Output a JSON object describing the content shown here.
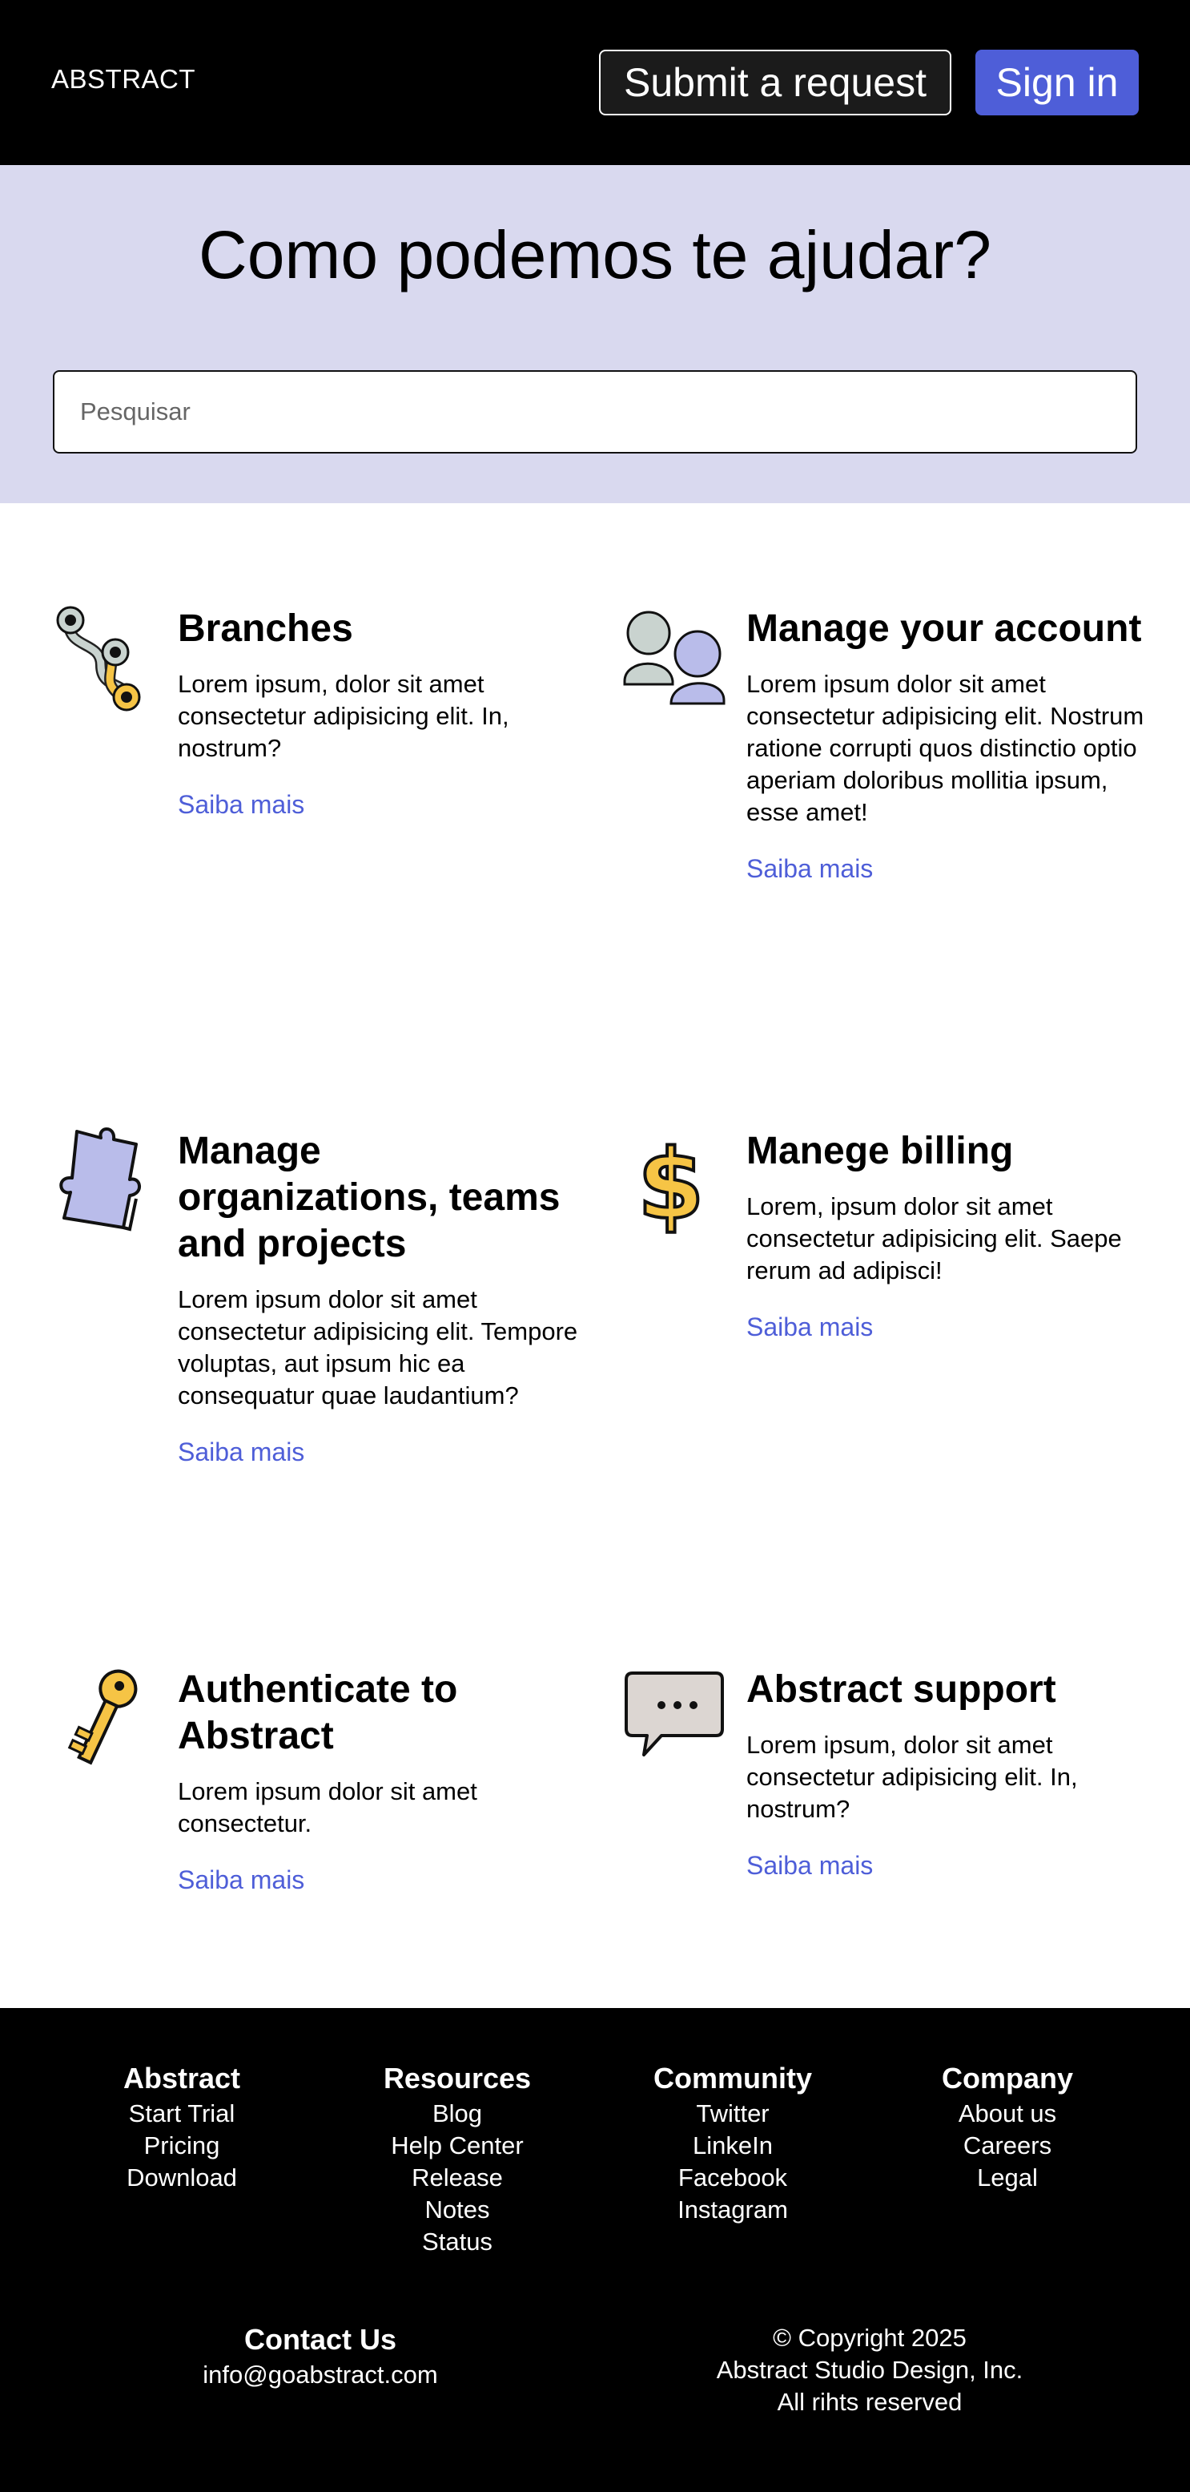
{
  "header": {
    "logo": "ABSTRACT",
    "submit_label": "Submit a request",
    "signin_label": "Sign in"
  },
  "hero": {
    "title": "Como podemos te ajudar?",
    "search_placeholder": "Pesquisar"
  },
  "cards": [
    {
      "title": "Branches",
      "text": "Lorem ipsum, dolor sit amet consectetur adipisicing elit. In, nostrum?",
      "link": "Saiba mais",
      "icon": "branches-icon"
    },
    {
      "title": "Manage your account",
      "text": "Lorem ipsum dolor sit amet consectetur adipisicing elit. Nostrum ratione corrupti quos distinctio optio aperiam doloribus mollitia ipsum, esse amet!",
      "link": "Saiba mais",
      "icon": "users-icon"
    },
    {
      "title": "Manage organizations, teams and projects",
      "text": "Lorem ipsum dolor sit amet consectetur adipisicing elit. Tempore voluptas, aut ipsum hic ea consequatur quae laudantium?",
      "link": "Saiba mais",
      "icon": "puzzle-icon"
    },
    {
      "title": "Manege billing",
      "text": "Lorem, ipsum dolor sit amet consectetur adipisicing elit. Saepe rerum ad adipisci!",
      "link": "Saiba mais",
      "icon": "dollar-icon"
    },
    {
      "title": "Authenticate to Abstract",
      "text": "Lorem ipsum dolor sit amet consectetur.",
      "link": "Saiba mais",
      "icon": "key-icon"
    },
    {
      "title": "Abstract support",
      "text": "Lorem ipsum, dolor sit amet consectetur adipisicing elit. In, nostrum?",
      "link": "Saiba mais",
      "icon": "chat-bubble-icon"
    }
  ],
  "footer": {
    "columns": [
      {
        "title": "Abstract",
        "links": [
          "Start Trial",
          "Pricing",
          "Download"
        ]
      },
      {
        "title": "Resources",
        "links": [
          "Blog",
          "Help Center",
          "Release",
          "Notes",
          "Status"
        ]
      },
      {
        "title": "Community",
        "links": [
          "Twitter",
          "LinkeIn",
          "Facebook",
          "Instagram"
        ]
      },
      {
        "title": "Company",
        "links": [
          "About us",
          "Careers",
          "Legal"
        ]
      }
    ],
    "contact_title": "Contact Us",
    "contact_email": "info@goabstract.com",
    "copyright": [
      "© Copyright 2025",
      "Abstract Studio Design, Inc.",
      "All rihts reserved"
    ]
  },
  "colors": {
    "accent": "#4e5ed8",
    "hero_bg": "#d9d9ef",
    "header_bg": "#000000",
    "icon_yellow": "#f6c445",
    "icon_lavender": "#b9bcea",
    "icon_gray": "#c9d3cf"
  }
}
